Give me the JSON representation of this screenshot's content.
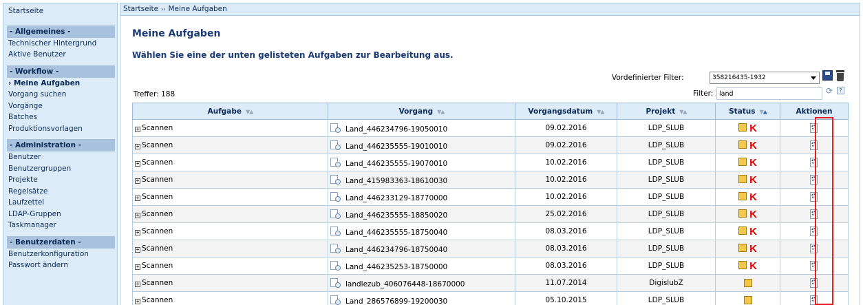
{
  "sidebar": {
    "start": "Startseite",
    "sections": [
      {
        "title": "- Allgemeines -",
        "items": [
          {
            "label": "Technischer Hintergrund"
          },
          {
            "label": "Aktive Benutzer"
          }
        ]
      },
      {
        "title": "- Workflow -",
        "items": [
          {
            "label": "› Meine Aufgaben",
            "active": true
          },
          {
            "label": "Vorgang suchen"
          },
          {
            "label": "Vorgänge"
          },
          {
            "label": "Batches"
          },
          {
            "label": "Produktionsvorlagen"
          }
        ]
      },
      {
        "title": "- Administration -",
        "items": [
          {
            "label": "Benutzer"
          },
          {
            "label": "Benutzergruppen"
          },
          {
            "label": "Projekte"
          },
          {
            "label": "Regelsätze"
          },
          {
            "label": "Laufzettel"
          },
          {
            "label": "LDAP-Gruppen"
          },
          {
            "label": "Taskmanager"
          }
        ]
      },
      {
        "title": "- Benutzerdaten -",
        "items": [
          {
            "label": "Benutzerkonfiguration"
          },
          {
            "label": "Passwort ändern"
          }
        ]
      }
    ]
  },
  "breadcrumb": {
    "home": "Startseite",
    "separator": "››",
    "current": "Meine Aufgaben"
  },
  "page": {
    "title": "Meine Aufgaben",
    "subtitle": "Wählen Sie eine der unten gelisteten Aufgaben zur Bearbeitung aus."
  },
  "filters": {
    "preset_label": "Vordefinierter Filter:",
    "preset_value": "358216435-1932",
    "filter_label": "Filter:",
    "filter_value": "land",
    "hits": "Treffer: 188"
  },
  "table": {
    "columns": [
      "Aufgabe",
      "Vorgang",
      "Vorgangsdatum",
      "Projekt",
      "Status",
      "Aktionen"
    ],
    "rows": [
      {
        "task": "Scannen",
        "process": "Land_446234796-19050010",
        "date": "09.02.2016",
        "project": "LDP_SLUB",
        "flag": "K"
      },
      {
        "task": "Scannen",
        "process": "Land_446235555-19010010",
        "date": "09.02.2016",
        "project": "LDP_SLUB",
        "flag": "K"
      },
      {
        "task": "Scannen",
        "process": "Land_446235555-19070010",
        "date": "10.02.2016",
        "project": "LDP_SLUB",
        "flag": "K"
      },
      {
        "task": "Scannen",
        "process": "Land_415983363-18610030",
        "date": "10.02.2016",
        "project": "LDP_SLUB",
        "flag": "K"
      },
      {
        "task": "Scannen",
        "process": "Land_446233129-18770000",
        "date": "10.02.2016",
        "project": "LDP_SLUB",
        "flag": "K"
      },
      {
        "task": "Scannen",
        "process": "Land_446235555-18850020",
        "date": "25.02.2016",
        "project": "LDP_SLUB",
        "flag": "K"
      },
      {
        "task": "Scannen",
        "process": "Land_446235555-18750040",
        "date": "08.03.2016",
        "project": "LDP_SLUB",
        "flag": "K"
      },
      {
        "task": "Scannen",
        "process": "Land_446234796-18750040",
        "date": "08.03.2016",
        "project": "LDP_SLUB",
        "flag": "K"
      },
      {
        "task": "Scannen",
        "process": "Land_446235253-18750000",
        "date": "08.03.2016",
        "project": "LDP_SLUB",
        "flag": "K"
      },
      {
        "task": "Scannen",
        "process": "landlezub_406076448-18670000",
        "date": "11.07.2014",
        "project": "DigislubZ",
        "flag": ""
      },
      {
        "task": "Scannen",
        "process": "Land_286576899-19200030",
        "date": "05.10.2015",
        "project": "LDP_SLUB",
        "flag": ""
      }
    ]
  },
  "colors": {
    "accent": "#1a3a78",
    "panel": "#dcebf8",
    "status": "#f2c94c",
    "flag": "#e00000",
    "highlight": "#e02020"
  },
  "icons": {
    "expand": "plus-box-icon",
    "process": "document-magnifier-icon",
    "action": "gear-document-icon",
    "save": "floppy-disk-icon",
    "delete": "trash-icon",
    "refresh": "refresh-icon",
    "help": "help-icon"
  }
}
